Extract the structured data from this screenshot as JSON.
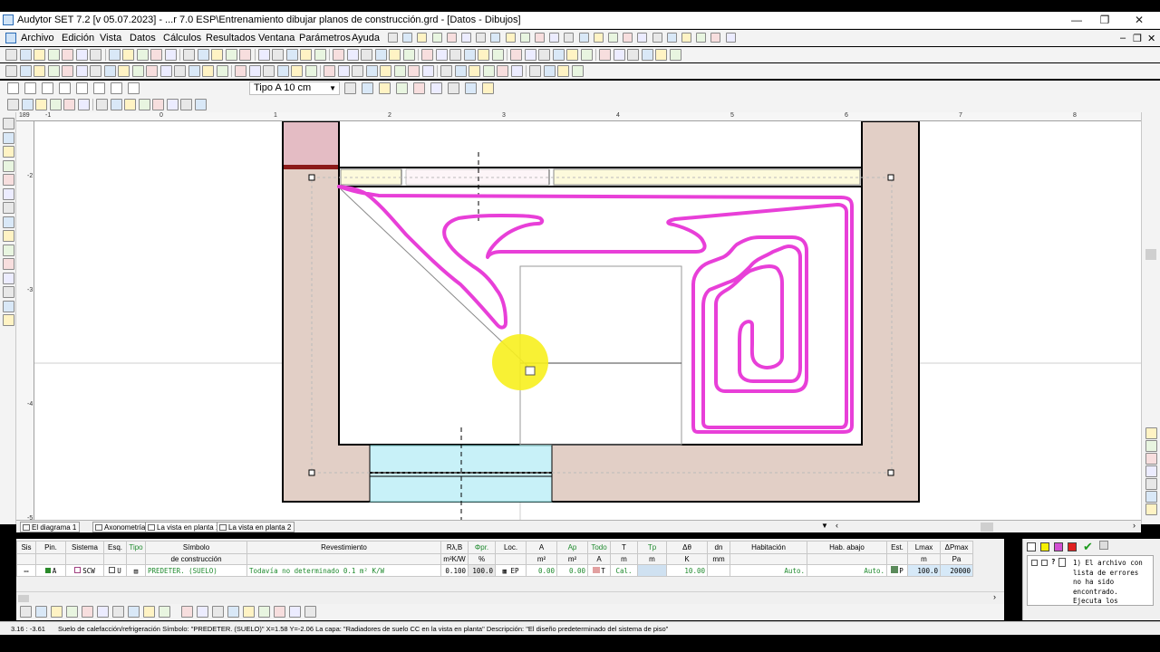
{
  "window": {
    "title": "Audytor SET 7.2  [v 05.07.2023] - ...r 7.0 ESP\\Entrenamiento dibujar planos de construcción.grd - [Datos - Dibujos]",
    "minimize": "—",
    "restore": "❐",
    "close": "✕"
  },
  "menu": {
    "items": [
      "Archivo",
      "Edición",
      "Vista",
      "Datos",
      "Cálculos",
      "Resultados",
      "Ventana",
      "Parámetros",
      "Ayuda"
    ],
    "mdi_min": "–",
    "mdi_restore": "❐",
    "mdi_close": "✕"
  },
  "toolbar": {
    "wall_type_label": "Tipo A 10 cm"
  },
  "ruler": {
    "corner": "189",
    "top_ticks": [
      "-1",
      "0",
      "1",
      "2",
      "3",
      "4",
      "5",
      "6",
      "7",
      "8"
    ],
    "left_ticks": [
      "-2",
      "-3",
      "-4",
      "-5"
    ]
  },
  "tabs": [
    "El diagrama 1",
    "Axonometría",
    "La vista en planta 1",
    "La vista en planta 2"
  ],
  "table": {
    "headers": [
      "Sis",
      "Pin.",
      "Sistema",
      "Esq.",
      "Tipo",
      "Símbolo",
      "Revestimiento",
      "Rλ,B",
      "Φpr.",
      "Loc.",
      "A",
      "Ap",
      "Todo",
      "T",
      "Tp",
      "Δθ",
      "dn",
      "Habitación",
      "Hab. abajo",
      "Est.",
      "Lmax",
      "ΔPmax"
    ],
    "subheader_symbol": "de construcción",
    "units": [
      "m²K/W",
      "%",
      "m²",
      "m²",
      "A",
      "m",
      "m",
      "K",
      "mm",
      "m",
      "Pa"
    ],
    "row": {
      "pin": "A",
      "sistema": "SCW",
      "esq": "U",
      "simbolo": "PREDETER. (SUELO)",
      "revestimiento": "Todavía no determinado 0.1 m² K/W",
      "r": "0.100",
      "phi": "100.0",
      "loc": "EP",
      "a": "0.00",
      "ap": "0.00",
      "todo": "T",
      "t": "Cal.",
      "dtheta": "10.00",
      "habitacion": "Auto.",
      "hab_abajo": "Auto.",
      "est": "P",
      "lmax": "100.0",
      "dpmax": "20000"
    }
  },
  "errors": {
    "message": "1) El archivo con lista de errores no ha sido encontrado. Ejecuta los"
  },
  "status": {
    "coords": "3.16 : -3.61",
    "text": "Suelo de calefacción/refrigeración  Símbolo: \"PREDETER. (SUELO)\"   X=1.58  Y=-2.06  La capa: \"Radiadores de suelo CC en la vista en planta\"   Descripción: \"El diseño predeterminado del sistema de piso\""
  },
  "colors": {
    "pipe": "#e83fd8",
    "wall_fill": "#e2cfc6",
    "window_fill": "#fdfadc",
    "door_fill": "#c8f1f8",
    "cursor_highlight": "#f7ef1e",
    "accent_pink": "#e4bcc4"
  }
}
